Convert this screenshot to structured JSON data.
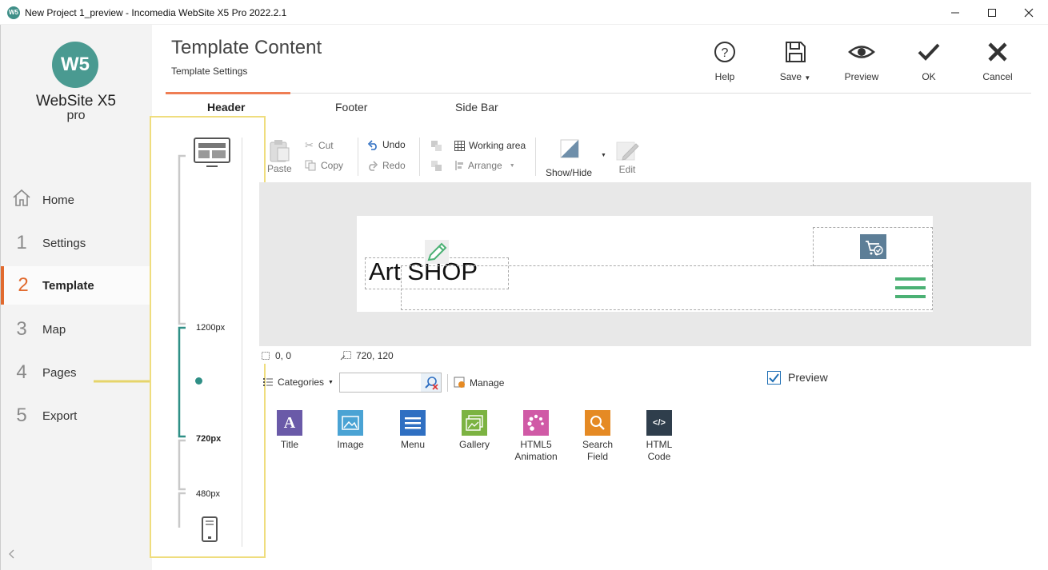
{
  "window": {
    "app_icon": "W5",
    "title": "New Project 1_preview - Incomedia WebSite X5 Pro 2022.2.1"
  },
  "sidebar": {
    "logo_mark": "W5",
    "logo_text": "WebSite X5",
    "logo_sub": "pro",
    "items": [
      {
        "num": "",
        "label": "Home",
        "icon": "home-icon"
      },
      {
        "num": "1",
        "label": "Settings"
      },
      {
        "num": "2",
        "label": "Template",
        "active": true
      },
      {
        "num": "3",
        "label": "Map"
      },
      {
        "num": "4",
        "label": "Pages"
      },
      {
        "num": "5",
        "label": "Export"
      }
    ],
    "collapse_icon": "chevron-left-icon"
  },
  "header": {
    "title": "Template Content",
    "subtitle": "Template Settings",
    "tools": [
      {
        "label": "Help",
        "icon": "help-icon"
      },
      {
        "label": "Save",
        "icon": "save-icon",
        "dropdown": true
      },
      {
        "label": "Preview",
        "icon": "eye-icon"
      },
      {
        "label": "OK",
        "icon": "check-icon"
      },
      {
        "label": "Cancel",
        "icon": "cancel-icon"
      }
    ]
  },
  "tabs": [
    "Header",
    "Footer",
    "Side Bar"
  ],
  "breakpoints": {
    "labels": [
      "1200px",
      "720px",
      "480px"
    ],
    "active": "720px"
  },
  "toolbar": {
    "paste": "Paste",
    "cut": "Cut",
    "copy": "Copy",
    "undo": "Undo",
    "redo": "Redo",
    "working_area": "Working area",
    "arrange": "Arrange",
    "show_hide": "Show/Hide",
    "edit": "Edit"
  },
  "canvas": {
    "site_title": "Art SHOP",
    "position": "0, 0",
    "size": "720, 120"
  },
  "objects": {
    "categories": "Categories",
    "search_value": "",
    "manage": "Manage",
    "preview_label": "Preview",
    "preview_checked": true,
    "items": [
      {
        "label": "Title",
        "color": "#6a5aa8",
        "icon": "title-icon"
      },
      {
        "label": "Image",
        "color": "#4aa3d4",
        "icon": "image-icon"
      },
      {
        "label": "Menu",
        "color": "#2f6fc2",
        "icon": "menu-icon"
      },
      {
        "label": "Gallery",
        "color": "#7cb342",
        "icon": "gallery-icon"
      },
      {
        "label": "HTML5\nAnimation",
        "color": "#d05aa6",
        "icon": "animation-icon"
      },
      {
        "label": "Search\nField",
        "color": "#e58a24",
        "icon": "search-field-icon"
      },
      {
        "label": "HTML\nCode",
        "color": "#2f3e4c",
        "icon": "code-icon"
      }
    ]
  },
  "colors": {
    "accent": "#e16a2e",
    "teal": "#2f8f86",
    "highlight": "#efdd7e",
    "menu_green": "#4bb174"
  }
}
